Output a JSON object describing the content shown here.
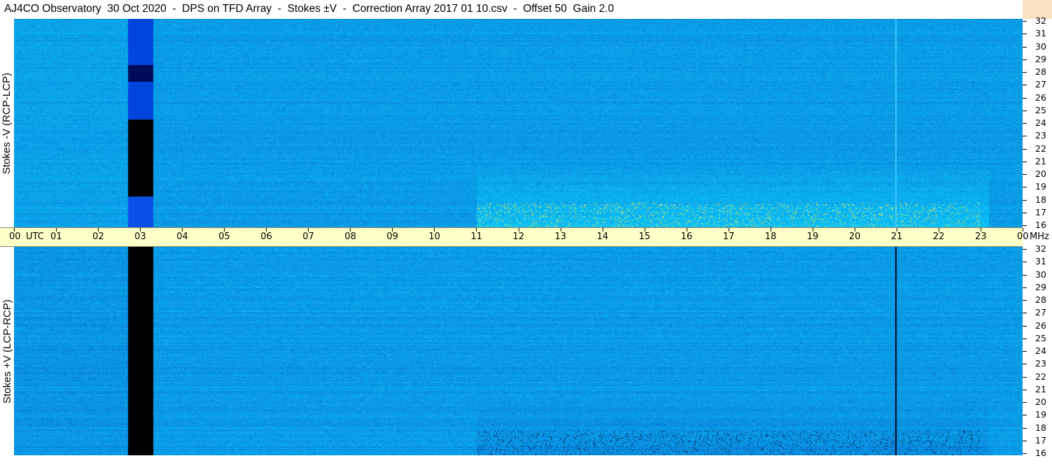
{
  "title": "AJ4CO Observatory  30 Oct 2020  -  DPS on TFD Array  -  Stokes ±V  -  Correction Array 2017 01 10.csv  -  Offset 50  Gain 2.0",
  "chart_data": [
    {
      "type": "heatmap",
      "panel": "top",
      "ylabel": "Stokes -V (RCP-LCP)",
      "x_ticks": [
        "00 UTC",
        "01",
        "02",
        "03",
        "04",
        "05",
        "06",
        "07",
        "08",
        "09",
        "10",
        "11",
        "12",
        "13",
        "14",
        "15",
        "16",
        "17",
        "18",
        "19",
        "20",
        "21",
        "22",
        "23",
        "00"
      ],
      "y_ticks": [
        16,
        17,
        18,
        19,
        20,
        21,
        22,
        23,
        24,
        25,
        26,
        27,
        28,
        29,
        30,
        31,
        32
      ],
      "y_unit": "MHz",
      "xlim_hours": [
        0,
        24
      ],
      "ylim_mhz": [
        16,
        32
      ],
      "colors": {
        "base": "#1a6fe0",
        "dark": "#000000",
        "bright": "#ffff40"
      }
    },
    {
      "type": "heatmap",
      "panel": "bottom",
      "ylabel": "Stokes +V (LCP-RCP)",
      "x_ticks": [
        "00 UTC",
        "01",
        "02",
        "03",
        "04",
        "05",
        "06",
        "07",
        "08",
        "09",
        "10",
        "11",
        "12",
        "13",
        "14",
        "15",
        "16",
        "17",
        "18",
        "19",
        "20",
        "21",
        "22",
        "23",
        "00"
      ],
      "y_ticks": [
        16,
        17,
        18,
        19,
        20,
        21,
        22,
        23,
        24,
        25,
        26,
        27,
        28,
        29,
        30,
        31,
        32
      ],
      "y_unit": "MHz",
      "xlim_hours": [
        0,
        24
      ],
      "ylim_mhz": [
        16,
        32
      ],
      "colors": {
        "base": "#1a6fe0",
        "dark": "#000000",
        "bright": "#ffff40"
      }
    }
  ],
  "time_axis": {
    "labels": [
      "00",
      "UTC",
      "01",
      "02",
      "03",
      "04",
      "05",
      "06",
      "07",
      "08",
      "09",
      "10",
      "11",
      "12",
      "13",
      "14",
      "15",
      "16",
      "17",
      "18",
      "19",
      "20",
      "21",
      "22",
      "23",
      "00",
      "MHz"
    ]
  }
}
